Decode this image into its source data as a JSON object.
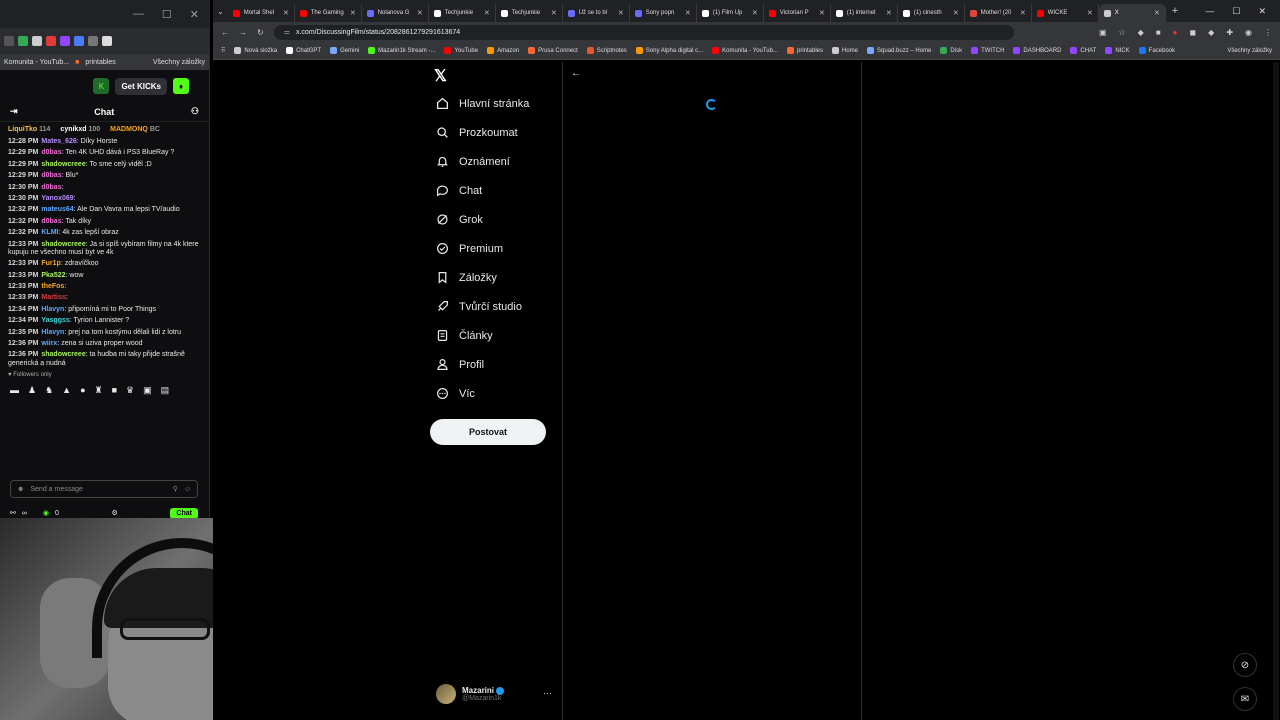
{
  "chat_browser": {
    "bookmarks": [
      "Komunita - YouTub...",
      "printables",
      "Všechny záložky"
    ],
    "get_kicks": "Get KICKs",
    "chat_title": "Chat",
    "pinned": [
      {
        "name": "LiquiTko",
        "count": "114",
        "color": "#f4c542"
      },
      {
        "name": "cynikxd",
        "count": "100",
        "color": "#ffffff"
      },
      {
        "name": "MADMONQ",
        "count": "BC",
        "color": "#f5a623"
      }
    ],
    "messages": [
      {
        "time": "12:28 PM",
        "user": "Mates_626",
        "color": "#b98aff",
        "text": "Díky Horste"
      },
      {
        "time": "12:29 PM",
        "user": "d0bas",
        "color": "#f06bd5",
        "text": "Ten 4K UHD dává i PS3 BlueRay ?"
      },
      {
        "time": "12:29 PM",
        "user": "shadowcreee",
        "color": "#a6f05f",
        "text": "To sme celý viděl :D"
      },
      {
        "time": "12:29 PM",
        "user": "d0bas",
        "color": "#f06bd5",
        "text": "Blu*"
      },
      {
        "time": "12:30 PM",
        "user": "d0bas",
        "color": "#f06bd5",
        "text": ""
      },
      {
        "time": "12:30 PM",
        "user": "Yanox069",
        "color": "#b98aff",
        "text": ""
      },
      {
        "time": "12:32 PM",
        "user": "mateus64",
        "color": "#5fa8ff",
        "text": "Ale Dan Vavra ma lepsi TV/audio"
      },
      {
        "time": "12:32 PM",
        "user": "d0bas",
        "color": "#f06bd5",
        "text": "Tak díky"
      },
      {
        "time": "12:32 PM",
        "user": "KLMI",
        "color": "#5fa8ff",
        "text": "4k zas lepší obraz"
      },
      {
        "time": "12:33 PM",
        "user": "shadowcreee",
        "color": "#a6f05f",
        "text": "Ja si spíš vybíram filmy na 4k ktere kupuju ne všechno musí byt ve 4k"
      },
      {
        "time": "12:33 PM",
        "user": "Fur1p",
        "color": "#f5a623",
        "text": "zdravíčkoo"
      },
      {
        "time": "12:33 PM",
        "user": "Pka522",
        "color": "#a6f05f",
        "text": "wow"
      },
      {
        "time": "12:33 PM",
        "user": "theFos",
        "color": "#f5a623",
        "text": ""
      },
      {
        "time": "12:33 PM",
        "user": "Martiss",
        "color": "#e03a3a",
        "text": ""
      },
      {
        "time": "12:34 PM",
        "user": "Hlavyn",
        "color": "#5fa8ff",
        "text": "připomíná mi to Poor Things"
      },
      {
        "time": "12:34 PM",
        "user": "Yasggss",
        "color": "#3ad6d6",
        "text": "Tyrion Lannister ?"
      },
      {
        "time": "12:35 PM",
        "user": "Hlavyn",
        "color": "#5fa8ff",
        "text": "prej na tom kostýmu dělali lidi z lotru"
      },
      {
        "time": "12:36 PM",
        "user": "wiirx",
        "color": "#5fa8ff",
        "text": "zena si uziva proper wood"
      },
      {
        "time": "12:36 PM",
        "user": "shadowcreee",
        "color": "#a6f05f",
        "text": "ta hudba mi taky přijde strašně generická a nudná"
      }
    ],
    "followers_only": "Followers only",
    "send_placeholder": "Send a message",
    "viewers": "∞",
    "points": "0",
    "chat_button": "Chat"
  },
  "browser": {
    "tabs": [
      {
        "label": "Mortal Shel",
        "color": "#ff0000"
      },
      {
        "label": "The Gaming",
        "color": "#ff0000"
      },
      {
        "label": "Nolanova G",
        "color": "#6b6bff"
      },
      {
        "label": "Techjunkie",
        "color": "#ffffff"
      },
      {
        "label": "Techjunkie",
        "color": "#ffffff"
      },
      {
        "label": "Už se to bl",
        "color": "#6b6bff"
      },
      {
        "label": "Sony popn",
        "color": "#6b6bff"
      },
      {
        "label": "(1) Film Up",
        "color": "#ffffff"
      },
      {
        "label": "Victorian P",
        "color": "#ff0000"
      },
      {
        "label": "(1) internet",
        "color": "#ffffff"
      },
      {
        "label": "(1) cinesth",
        "color": "#ffffff"
      },
      {
        "label": "Mother! (20",
        "color": "#e0463a"
      },
      {
        "label": "WICKE",
        "color": "#ff0000"
      },
      {
        "label": "X",
        "color": "#cccccc"
      }
    ],
    "url": "x.com/DiscussingFilm/status/2082861279291613674",
    "bookmarks": [
      {
        "label": "Nová složka",
        "color": "#cccccc"
      },
      {
        "label": "ChatGPT",
        "color": "#ffffff"
      },
      {
        "label": "Gemini",
        "color": "#7aa7ff"
      },
      {
        "label": "Mazarin1k Stream -...",
        "color": "#53fc18"
      },
      {
        "label": "YouTube",
        "color": "#ff0000"
      },
      {
        "label": "Amazon",
        "color": "#ff9900"
      },
      {
        "label": "Prusa Connect",
        "color": "#fa6831"
      },
      {
        "label": "Scriptnotes",
        "color": "#e05a2b"
      },
      {
        "label": "Sony Alpha digital c...",
        "color": "#ff9900"
      },
      {
        "label": "Komunita - YouTub...",
        "color": "#ff0000"
      },
      {
        "label": "printables",
        "color": "#fa6831"
      },
      {
        "label": "Home",
        "color": "#cccccc"
      },
      {
        "label": "Squad.buzz – Home",
        "color": "#7aa7ff"
      },
      {
        "label": "Disk",
        "color": "#34a853"
      },
      {
        "label": "TWITCH",
        "color": "#9146ff"
      },
      {
        "label": "DASHBOARD",
        "color": "#9146ff"
      },
      {
        "label": "CHAT",
        "color": "#9146ff"
      },
      {
        "label": "NICK",
        "color": "#9146ff"
      },
      {
        "label": "Facebook",
        "color": "#1877f2"
      }
    ],
    "all_bookmarks": "Všechny záložky"
  },
  "x": {
    "nav": [
      {
        "label": "Hlavní stránka",
        "icon": "home-icon"
      },
      {
        "label": "Prozkoumat",
        "icon": "search-icon"
      },
      {
        "label": "Oznámení",
        "icon": "bell-icon"
      },
      {
        "label": "Chat",
        "icon": "chat-icon"
      },
      {
        "label": "Grok",
        "icon": "grok-icon"
      },
      {
        "label": "Premium",
        "icon": "premium-icon"
      },
      {
        "label": "Záložky",
        "icon": "bookmark-icon"
      },
      {
        "label": "Tvůrčí studio",
        "icon": "rocket-icon"
      },
      {
        "label": "Články",
        "icon": "article-icon"
      },
      {
        "label": "Profil",
        "icon": "profile-icon"
      },
      {
        "label": "Víc",
        "icon": "more-circle-icon"
      }
    ],
    "post_button": "Postovat",
    "account_name": "Mazarini",
    "account_handle": "@Mazarin1k"
  }
}
